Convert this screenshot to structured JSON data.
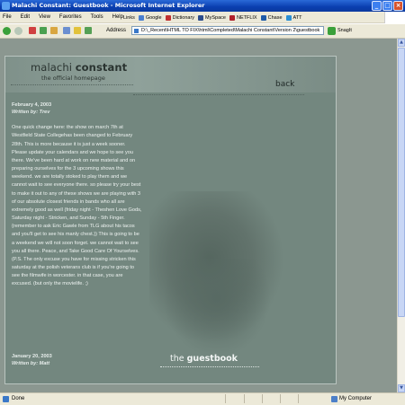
{
  "window": {
    "title": "Malachi Constant: Guestbook - Microsoft Internet Explorer",
    "buttons": [
      "_",
      "□",
      "×"
    ]
  },
  "menubar": {
    "items": [
      "File",
      "Edit",
      "View",
      "Favorites",
      "Tools",
      "Help"
    ],
    "links_label": "Links",
    "links": [
      "Google",
      "Dictionary",
      "MySpace",
      "NETFLIX",
      "Chase",
      "ATT"
    ]
  },
  "toolbar": {
    "address_label": "Address",
    "address": "D:\\_Recent\\HTML TO FIX\\html\\Completed\\Malachi Constant\\Version 2\\guestbook",
    "snagit_label": "SnagIt"
  },
  "site": {
    "name_light": "malachi",
    "name_bold": "constant",
    "tagline": "the official homepage",
    "back_label": "back",
    "guestbook_light": "the",
    "guestbook_bold": "guestbook"
  },
  "posts": [
    {
      "date": "February 4, 2003",
      "author": "Written by: Trev",
      "body": "One quick change here: the show on march 7th at Westfield State Collegehas been changed to February 28th. This is more because it is just a week sooner. Please update your calendars and we hope to see you there. We've been hard at work on new material and on preparing ourselves for the 3 upcoming shows this weekend. we are totally stoked to play them and we cannot wait to see everyone there. so please try your best to make it out to any of these shows we are playing with 3 of our absolute closest friends in bands who all are extremely good as well (friday night - Theshen Love Gods, Saturday night - Stricken, and Sunday - 5th Finger. {remember to ask Eric Gawle from TLG about his tacos and you'll get to see his manly chest.}) This is going to be a weekend we will not soon forget. we cannot wait to see you all there. Peace, and Take Good Care Of Yourselves. (P.S. The only excuse you have for missing stricken this saturday at the polish veterans club is if you're going to see the filmwife in worcester. in that case, you are excused. (but only the movielife. ;)"
    },
    {
      "date": "January 20, 2003",
      "author": "Written by: Matt"
    }
  ],
  "statusbar": {
    "status": "Done",
    "zone": "My Computer"
  }
}
